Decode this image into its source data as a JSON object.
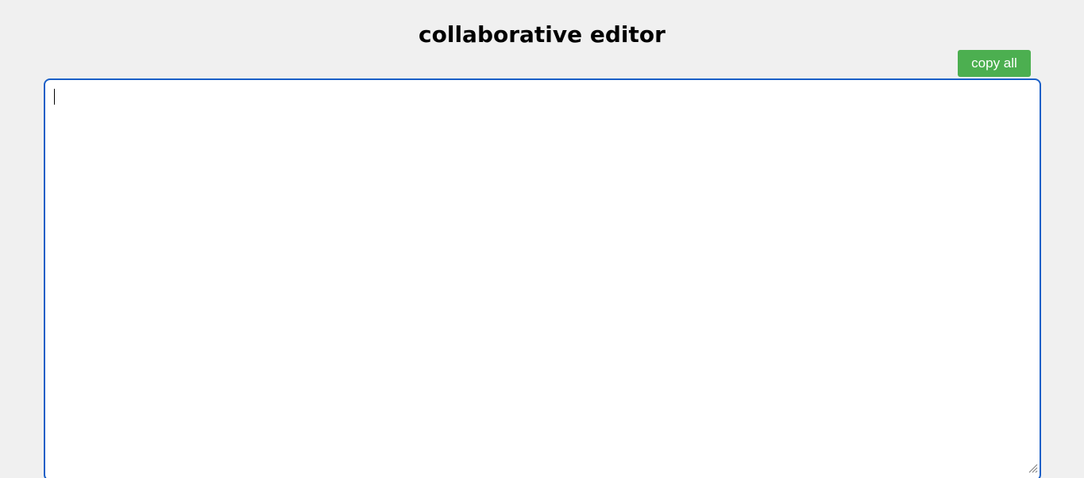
{
  "header": {
    "title": "collaborative editor"
  },
  "toolbar": {
    "copy_label": "copy all"
  },
  "editor": {
    "value": "",
    "placeholder": ""
  },
  "colors": {
    "background": "#f0f0f0",
    "button": "#4caf50",
    "editor_border": "#1a5fc7"
  },
  "icons": {
    "resize": "resize-grip-icon"
  }
}
